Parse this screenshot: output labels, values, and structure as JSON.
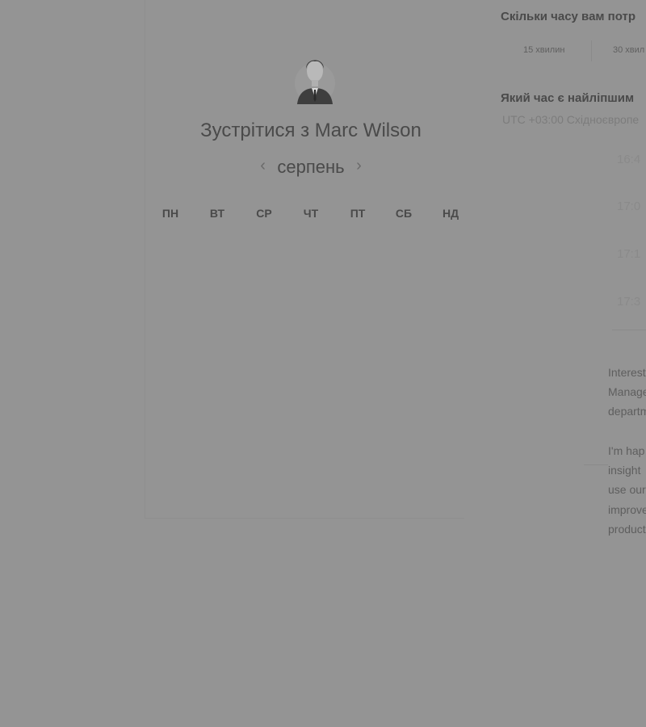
{
  "host": {
    "avatar_icon": "person-portrait-icon",
    "title": "Зустрітися з Marc Wilson"
  },
  "calendar": {
    "prev_icon": "chevron-left-icon",
    "next_icon": "chevron-right-icon",
    "prev_glyph": "‹",
    "next_glyph": "›",
    "month": "серпень",
    "weekdays": [
      "ПН",
      "ВТ",
      "СР",
      "ЧТ",
      "ПТ",
      "СБ",
      "НД"
    ]
  },
  "duration": {
    "question": "Скільки часу вам потр",
    "options": [
      "15 хвилин",
      "30 хвил"
    ]
  },
  "time": {
    "question": "Який час є найліпшим",
    "timezone": "UTC +03:00 Східноєвропе",
    "slots": [
      "16:4",
      "17:0",
      "17:1",
      "17:3"
    ]
  },
  "bio": {
    "lines_1": [
      "Interest",
      "Manage",
      "departm"
    ],
    "lines_2": [
      "I'm hap",
      "insight",
      "use our",
      "improve",
      "product"
    ]
  }
}
